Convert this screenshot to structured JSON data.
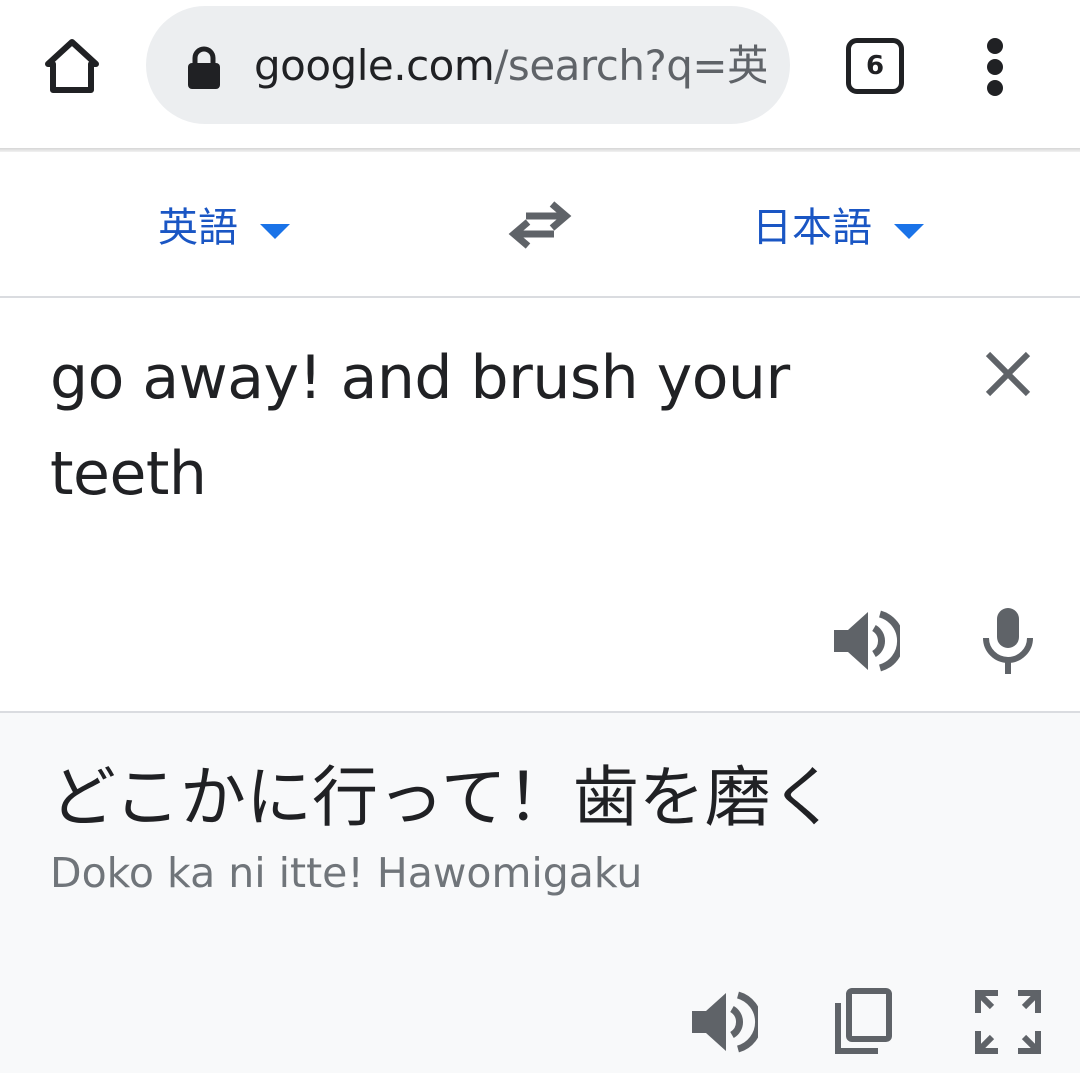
{
  "browser": {
    "url_host": "google.com",
    "url_rest": "/search?q=英",
    "tab_count": "6",
    "icons": [
      "home-icon",
      "lock-icon",
      "tab-switcher-icon",
      "more-vert-icon"
    ]
  },
  "translate": {
    "source_language": "英語",
    "target_language": "日本語",
    "source_text": "go away! and brush your teeth",
    "translated_text": "どこかに行って！歯を磨く",
    "romanization": "Doko ka ni itte! Hawomigaku",
    "icons": [
      "swap-icon",
      "close-icon",
      "speaker-icon",
      "mic-icon",
      "copy-icon",
      "fullscreen-icon"
    ],
    "accent_color": "#1a73e8"
  }
}
